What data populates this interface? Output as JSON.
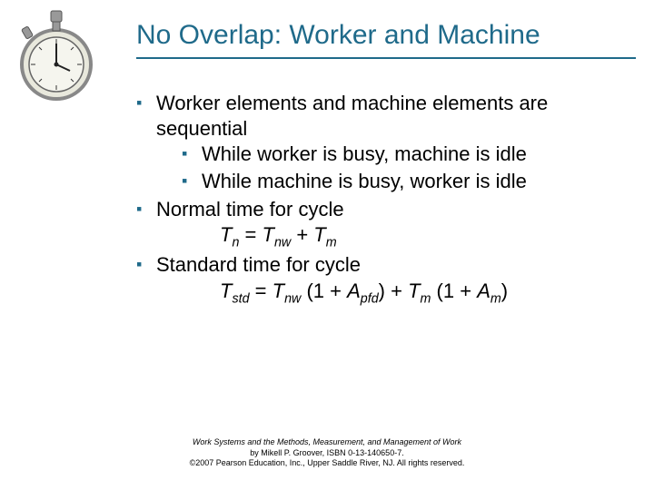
{
  "title": "No Overlap: Worker and Machine",
  "bullets": {
    "b1": "Worker elements and machine elements are sequential",
    "b1_sub1": "While worker is busy, machine is idle",
    "b1_sub2": "While machine is busy, worker is idle",
    "b2": "Normal time for cycle",
    "b3": "Standard time for cycle"
  },
  "formula1": {
    "T": "T",
    "n": "n",
    "eq": " = ",
    "Tnw_T": "T",
    "nw": "nw",
    "plus": " + ",
    "Tm_T": "T",
    "m": "m"
  },
  "formula2": {
    "T": "T",
    "std": "std",
    "eq": " = ",
    "Tnw_T": "T",
    "nw": "nw",
    "sp1": " (1 + ",
    "A1": "A",
    "pfd": "pfd",
    "cp1": ") + ",
    "Tm_T": "T",
    "m": "m",
    "sp2": " (1 + ",
    "A2": "A",
    "msub": "m",
    "cp2": ")"
  },
  "footer": {
    "line1": "Work Systems and the Methods, Measurement, and Management of Work",
    "line2": "by Mikell P. Groover, ISBN 0-13-140650-7.",
    "line3": "©2007 Pearson Education, Inc., Upper Saddle River, NJ.  All rights reserved."
  },
  "icon": {
    "name": "stopwatch-icon"
  }
}
